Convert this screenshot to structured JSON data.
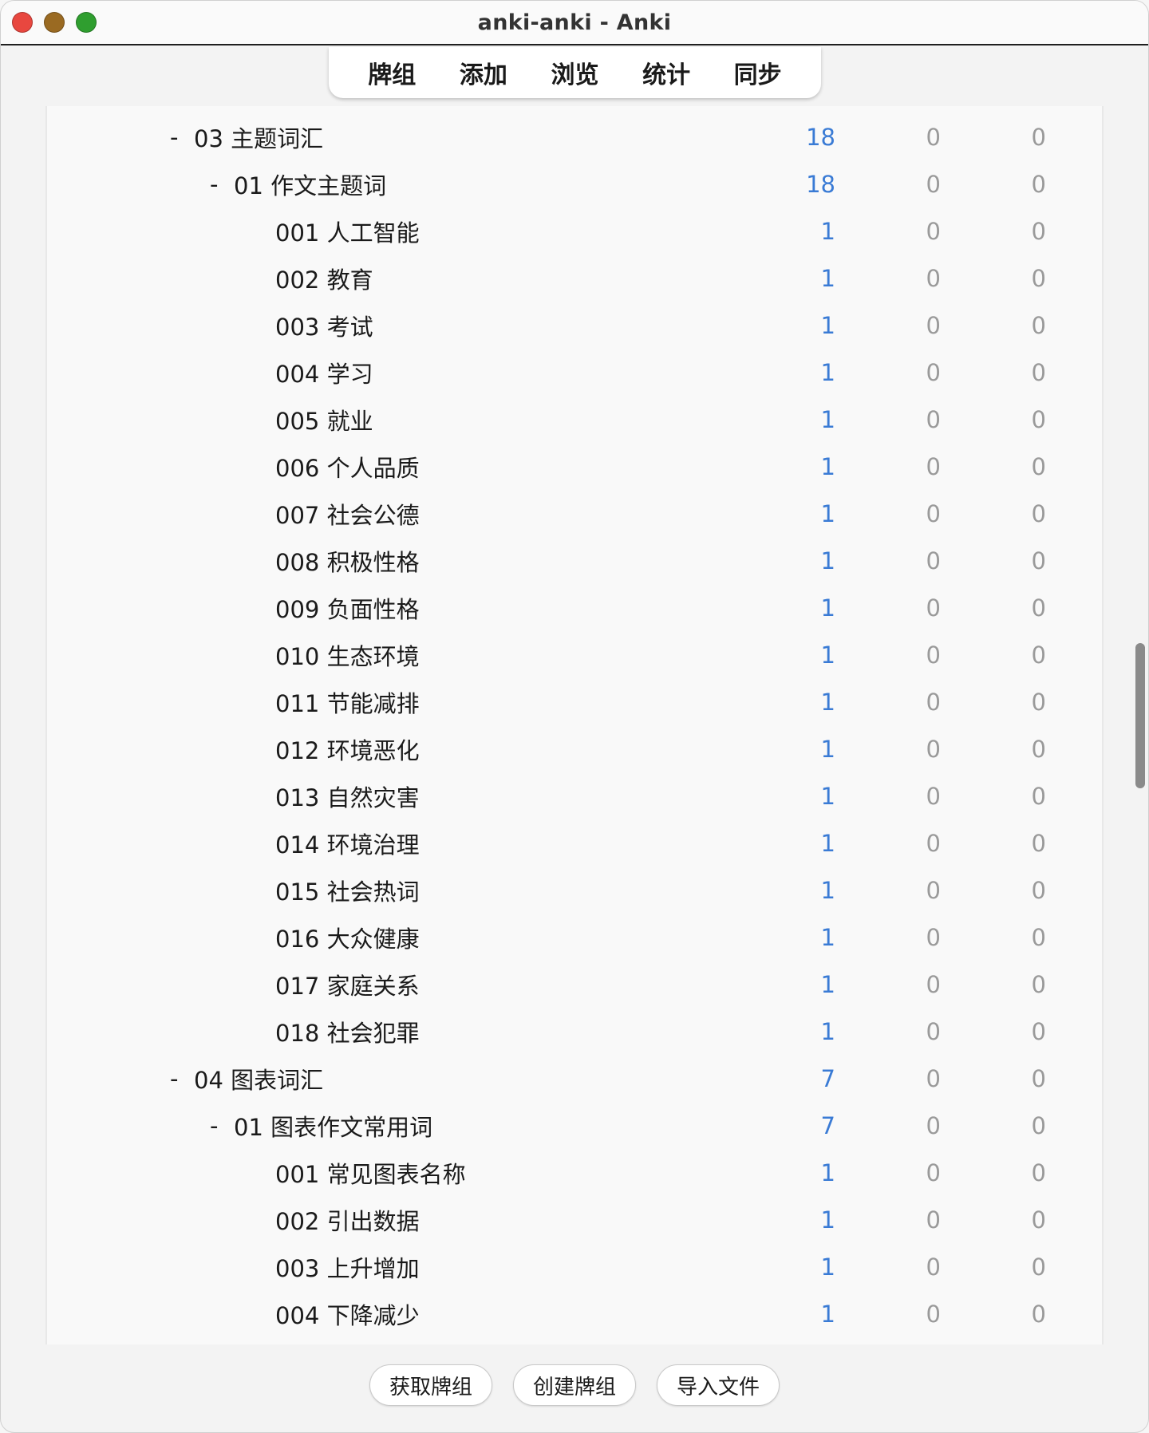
{
  "window": {
    "title": "anki-anki - Anki"
  },
  "toolbar": {
    "items": [
      "牌组",
      "添加",
      "浏览",
      "统计",
      "同步"
    ]
  },
  "decks": [
    {
      "level": 1,
      "collapsible": true,
      "collapse_glyph": "-",
      "name": "03 主题词汇",
      "new": "18",
      "learn": "0",
      "due": "0"
    },
    {
      "level": 2,
      "collapsible": true,
      "collapse_glyph": "-",
      "name": "01 作文主题词",
      "new": "18",
      "learn": "0",
      "due": "0"
    },
    {
      "level": 3,
      "collapsible": false,
      "name": "001 人工智能",
      "new": "1",
      "learn": "0",
      "due": "0"
    },
    {
      "level": 3,
      "collapsible": false,
      "name": "002 教育",
      "new": "1",
      "learn": "0",
      "due": "0"
    },
    {
      "level": 3,
      "collapsible": false,
      "name": "003 考试",
      "new": "1",
      "learn": "0",
      "due": "0"
    },
    {
      "level": 3,
      "collapsible": false,
      "name": "004 学习",
      "new": "1",
      "learn": "0",
      "due": "0"
    },
    {
      "level": 3,
      "collapsible": false,
      "name": "005 就业",
      "new": "1",
      "learn": "0",
      "due": "0"
    },
    {
      "level": 3,
      "collapsible": false,
      "name": "006 个人品质",
      "new": "1",
      "learn": "0",
      "due": "0"
    },
    {
      "level": 3,
      "collapsible": false,
      "name": "007 社会公德",
      "new": "1",
      "learn": "0",
      "due": "0"
    },
    {
      "level": 3,
      "collapsible": false,
      "name": "008 积极性格",
      "new": "1",
      "learn": "0",
      "due": "0"
    },
    {
      "level": 3,
      "collapsible": false,
      "name": "009 负面性格",
      "new": "1",
      "learn": "0",
      "due": "0"
    },
    {
      "level": 3,
      "collapsible": false,
      "name": "010 生态环境",
      "new": "1",
      "learn": "0",
      "due": "0"
    },
    {
      "level": 3,
      "collapsible": false,
      "name": "011 节能减排",
      "new": "1",
      "learn": "0",
      "due": "0"
    },
    {
      "level": 3,
      "collapsible": false,
      "name": "012 环境恶化",
      "new": "1",
      "learn": "0",
      "due": "0"
    },
    {
      "level": 3,
      "collapsible": false,
      "name": "013 自然灾害",
      "new": "1",
      "learn": "0",
      "due": "0"
    },
    {
      "level": 3,
      "collapsible": false,
      "name": "014 环境治理",
      "new": "1",
      "learn": "0",
      "due": "0"
    },
    {
      "level": 3,
      "collapsible": false,
      "name": "015 社会热词",
      "new": "1",
      "learn": "0",
      "due": "0"
    },
    {
      "level": 3,
      "collapsible": false,
      "name": "016 大众健康",
      "new": "1",
      "learn": "0",
      "due": "0"
    },
    {
      "level": 3,
      "collapsible": false,
      "name": "017 家庭关系",
      "new": "1",
      "learn": "0",
      "due": "0"
    },
    {
      "level": 3,
      "collapsible": false,
      "name": "018 社会犯罪",
      "new": "1",
      "learn": "0",
      "due": "0"
    },
    {
      "level": 1,
      "collapsible": true,
      "collapse_glyph": "-",
      "name": "04 图表词汇",
      "new": "7",
      "learn": "0",
      "due": "0"
    },
    {
      "level": 2,
      "collapsible": true,
      "collapse_glyph": "-",
      "name": "01 图表作文常用词",
      "new": "7",
      "learn": "0",
      "due": "0"
    },
    {
      "level": 3,
      "collapsible": false,
      "name": "001 常见图表名称",
      "new": "1",
      "learn": "0",
      "due": "0"
    },
    {
      "level": 3,
      "collapsible": false,
      "name": "002 引出数据",
      "new": "1",
      "learn": "0",
      "due": "0"
    },
    {
      "level": 3,
      "collapsible": false,
      "name": "003 上升增加",
      "new": "1",
      "learn": "0",
      "due": "0"
    },
    {
      "level": 3,
      "collapsible": false,
      "name": "004 下降减少",
      "new": "1",
      "learn": "0",
      "due": "0"
    }
  ],
  "bottom_buttons": [
    "获取牌组",
    "创建牌组",
    "导入文件"
  ],
  "colors": {
    "new_count": "#3a7bd5",
    "zero_count": "#9a9a9a"
  }
}
